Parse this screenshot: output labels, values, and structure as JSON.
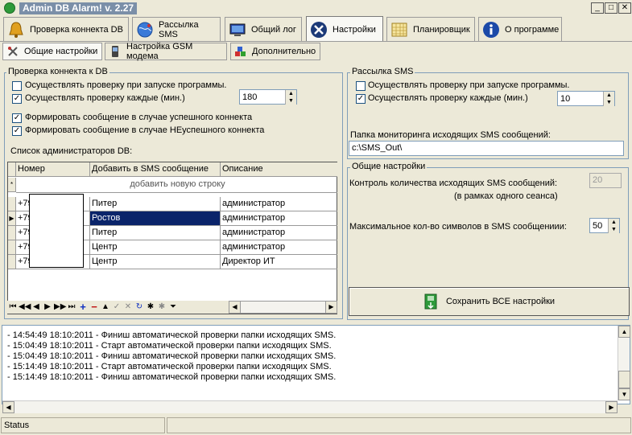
{
  "window": {
    "title": "Admin DB Alarm! v. 2.27"
  },
  "main_tabs": [
    {
      "label": "Проверка коннекта DB",
      "icon": "bell-icon"
    },
    {
      "label": "Рассылка SMS",
      "icon": "globe-icon"
    },
    {
      "label": "Общий лог",
      "icon": "monitor-icon"
    },
    {
      "label": "Настройки",
      "icon": "tools-icon"
    },
    {
      "label": "Планировщик",
      "icon": "calendar-icon"
    },
    {
      "label": "О программе",
      "icon": "info-icon"
    }
  ],
  "sub_tabs": [
    {
      "label": "Общие настройки",
      "icon": "tools-icon"
    },
    {
      "label": "Настройка GSM модема",
      "icon": "phone-icon"
    },
    {
      "label": "Дополнительно",
      "icon": "blocks-icon"
    }
  ],
  "db_group": {
    "title": "Проверка коннекта к DB",
    "check_on_start": {
      "label": "Осуществлять проверку при запуске программы.",
      "checked": false
    },
    "check_every": {
      "label": "Осуществлять проверку каждые (мин.)",
      "checked": true,
      "value": "180"
    },
    "msg_success": {
      "label": "Формировать сообщение в случае успешного коннекта",
      "checked": true
    },
    "msg_fail": {
      "label": "Формировать сообщение в случае НЕуспешного коннекта",
      "checked": true
    },
    "admin_list_label": "Список администраторов DB:",
    "grid": {
      "columns": [
        "Номер",
        "Добавить в SMS сообщение",
        "Описание"
      ],
      "add_row": "добавить новую строку",
      "rows": [
        {
          "number": "+79",
          "sms": "Питер",
          "desc": "администратор"
        },
        {
          "number": "+79",
          "sms": "Ростов",
          "desc": "администратор"
        },
        {
          "number": "+79",
          "sms": "Питер",
          "desc": "администратор"
        },
        {
          "number": "+79",
          "sms": "Центр",
          "desc": "администратор"
        },
        {
          "number": "+79",
          "sms": "Центр",
          "desc": "Директор ИТ"
        }
      ]
    }
  },
  "sms_group": {
    "title": "Рассылка SMS",
    "check_on_start": {
      "label": "Осуществлять проверку при запуске программы.",
      "checked": false
    },
    "check_every": {
      "label": "Осуществлять проверку каждые (мин.)",
      "checked": true,
      "value": "10"
    },
    "folder_label": "Папка мониторинга исходящих SMS сообщений:",
    "folder_value": "c:\\SMS_Out\\"
  },
  "general_group": {
    "title": "Общие настройки",
    "count_label": "Контроль количества исходящих SMS сообщений:",
    "count_sublabel": "(в рамках одного сеанса)",
    "count_value": "20",
    "max_label": "Максимальное кол-во символов в SMS сообщениии:",
    "max_value": "50"
  },
  "save_button": {
    "label": "Сохранить ВСЕ настройки",
    "icon": "save-icon"
  },
  "log_lines": [
    "- 14:54:49 18:10:2011 - Финиш автоматической проверки папки исходящих SMS.",
    "- 15:04:49 18:10:2011 - Старт автоматической проверки папки исходящих SMS.",
    "- 15:04:49 18:10:2011 - Финиш автоматической проверки папки исходящих SMS.",
    "- 15:14:49 18:10:2011 - Старт автоматической проверки папки исходящих SMS.",
    "- 15:14:49 18:10:2011 - Финиш автоматической проверки папки исходящих SMS."
  ],
  "status": {
    "text": "Status"
  }
}
